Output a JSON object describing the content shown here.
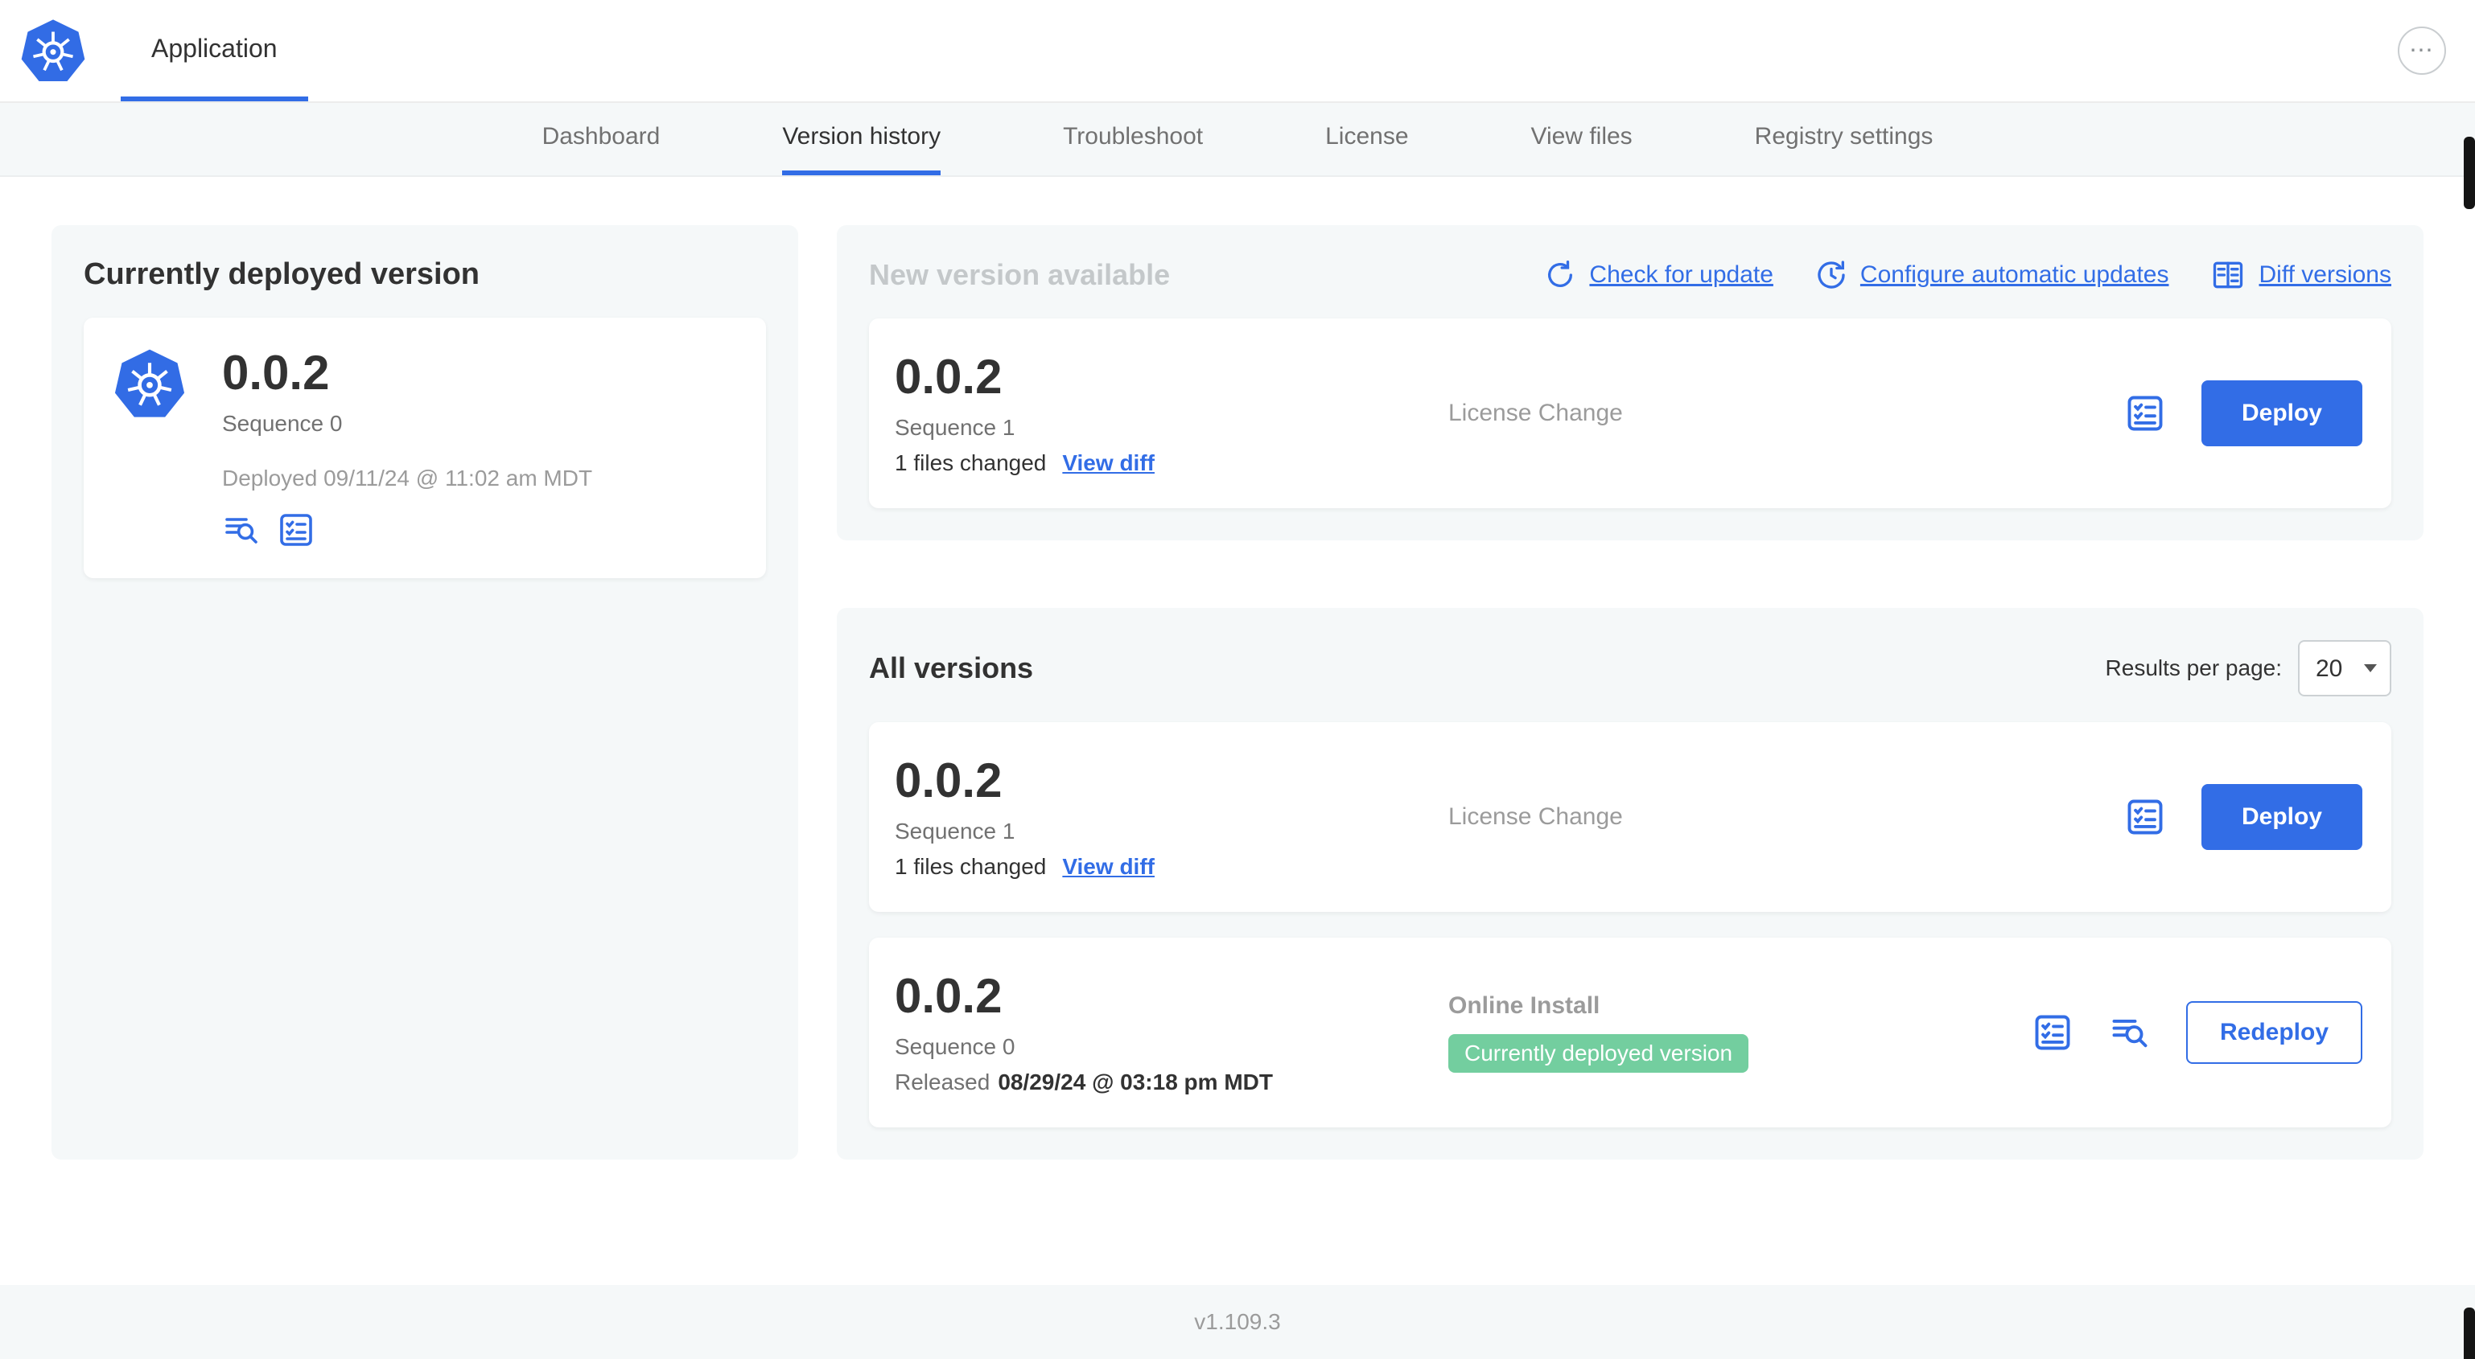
{
  "colors": {
    "accent": "#326de6",
    "success": "#73ce9f",
    "bg-section": "#f5f8f9",
    "text-primary": "#323232",
    "text-secondary": "#717171",
    "text-muted": "#9b9b9b",
    "title-disabled": "#c4c8ca"
  },
  "icons": {
    "ellipsis": "⋯"
  },
  "header": {
    "app_tab": "Application"
  },
  "nav": {
    "tabs": [
      {
        "label": "Dashboard"
      },
      {
        "label": "Version history"
      },
      {
        "label": "Troubleshoot"
      },
      {
        "label": "License"
      },
      {
        "label": "View files"
      },
      {
        "label": "Registry settings"
      }
    ]
  },
  "current_version": {
    "title": "Currently deployed version",
    "version": "0.0.2",
    "sequence": "Sequence 0",
    "deployed_at": "Deployed 09/11/24 @ 11:02 am MDT"
  },
  "new_version": {
    "title": "New version available",
    "check_for_update": "Check for update",
    "configure_updates": "Configure automatic updates",
    "diff_versions": "Diff versions",
    "card": {
      "version": "0.0.2",
      "sequence": "Sequence 1",
      "files_changed": "1 files changed",
      "view_diff": "View diff",
      "source": "License Change",
      "action": "Deploy"
    }
  },
  "all_versions": {
    "title": "All versions",
    "results_per_page_label": "Results per page:",
    "results_per_page": "20",
    "rows": [
      {
        "version": "0.0.2",
        "sequence": "Sequence 1",
        "files_changed": "1 files changed",
        "view_diff": "View diff",
        "source": "License Change",
        "action": "Deploy"
      },
      {
        "version": "0.0.2",
        "sequence": "Sequence 0",
        "released_label": "Released",
        "released_value": "08/29/24 @ 03:18 pm MDT",
        "source": "Online Install",
        "badge": "Currently deployed version",
        "action": "Redeploy"
      }
    ]
  },
  "footer": {
    "app_version": "v1.109.3"
  }
}
